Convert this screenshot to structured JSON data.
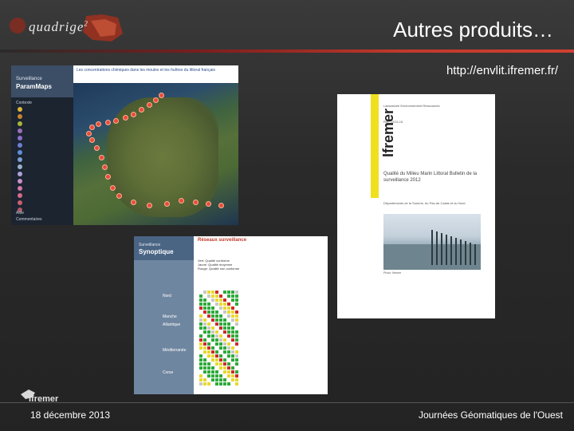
{
  "header": {
    "logo_text": "quadrige",
    "logo_superscript": "2",
    "title": "Autres produits…",
    "url": "http://envlit.ifremer.fr/"
  },
  "footer": {
    "date": "18 décembre 2013",
    "event": "Journées Géomatiques de l'Ouest",
    "logo_text": "Ifremer"
  },
  "map_screenshot": {
    "app_brand": "Surveillance",
    "app_name": "ParamMaps",
    "top_title": "Les concentrations chimiques dans les moules et les huîtres du littoral français",
    "sections": [
      "Contexte",
      "Aide",
      "Commentaires"
    ],
    "layer_colors": [
      "#d9b53a",
      "#c9842f",
      "#a9b43a",
      "#9a6fb8",
      "#8a6fc8",
      "#6e7ed0",
      "#5f8fd8",
      "#7aa0d0",
      "#9ab0c8",
      "#b0a0d8",
      "#c890c8",
      "#d07aa8",
      "#d86a88",
      "#c86070",
      "#b05868"
    ]
  },
  "synoptic_screenshot": {
    "app_brand": "Surveillance",
    "app_name": "Synoptique",
    "title": "Réseaux surveillance",
    "legend": [
      "Vert: Qualité conforme",
      "Jaune: Qualité moyenne",
      "Rouge: Qualité non conforme"
    ],
    "row_labels": [
      "Nord",
      "Manche",
      "Atlantique",
      "Méditerranée",
      "Corse"
    ],
    "cell_colors": {
      "green": "#2eaa3a",
      "yellow": "#e8d830",
      "red": "#d02a2a",
      "grey": "#c8c8c8"
    }
  },
  "document": {
    "vertical_logo": "Ifremer",
    "top_text": "Laboratoire Environnement Ressources",
    "ref_text": "Réf.: 2013-15",
    "title": "Qualité du Milieu Marin Littoral Bulletin de la surveillance 2012",
    "subtitle": "Départements de la Somme, du Pas-de-Calais et du Nord",
    "photo_caption": "Photo: Ifremer",
    "band_color": "#f0e020"
  }
}
